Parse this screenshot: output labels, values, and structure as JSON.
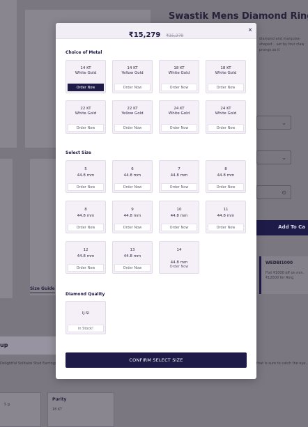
{
  "product": {
    "title": "Swastik Mens Diamond Ring",
    "description": "diamond and marquise-shaped... set by four claw prongs as it",
    "size_guide": "Size Guide",
    "add_to_cart": "Add To Ca",
    "offer": {
      "code": "WEDBI1000",
      "text": "Flat ₹1000 off on min. ₹12000 for Ring"
    }
  },
  "details": {
    "tab_label": "up",
    "paragraph_left": "Delightful Solitaire Stud Earrings... these earrings will stay in your...",
    "paragraph_right": "that is sure to catch the eye... your everyday look, the",
    "specs": [
      {
        "key": "",
        "value": "5 g"
      },
      {
        "key": "Purity",
        "value": "18 KT"
      }
    ]
  },
  "modal": {
    "price": "₹15,279",
    "old_price": "₹15,279",
    "close": "×",
    "metal_title": "Choice of Metal",
    "metal_options": [
      {
        "kt": "14 KT",
        "color": "White Gold",
        "action": "Order Now",
        "selected": true
      },
      {
        "kt": "14 KT",
        "color": "Yellow Gold",
        "action": "Order Now"
      },
      {
        "kt": "18 KT",
        "color": "White Gold",
        "action": "Order Now"
      },
      {
        "kt": "18 KT",
        "color": "White Gold",
        "action": "Order Now"
      },
      {
        "kt": "22 KT",
        "color": "White Gold",
        "action": "Order Now"
      },
      {
        "kt": "22 KT",
        "color": "Yellow Gold",
        "action": "Order Now"
      },
      {
        "kt": "24 KT",
        "color": "White Gold",
        "action": "Order Now"
      },
      {
        "kt": "24 KT",
        "color": "White Gold",
        "action": "Order Now"
      }
    ],
    "size_title": "Select Size",
    "size_options": [
      {
        "size": "5",
        "mm": "44.8 mm",
        "action": "Order Now"
      },
      {
        "size": "6",
        "mm": "44.8 mm",
        "action": "Order Now"
      },
      {
        "size": "7",
        "mm": "44.8 mm",
        "action": "Order Now"
      },
      {
        "size": "8",
        "mm": "44.8 mm",
        "action": "Order Now"
      },
      {
        "size": "8",
        "mm": "44.8 mm",
        "action": "Order Now"
      },
      {
        "size": "9",
        "mm": "44.8 mm",
        "action": "Order Now"
      },
      {
        "size": "10",
        "mm": "44.8 mm",
        "action": "Order Now"
      },
      {
        "size": "11",
        "mm": "44.8 mm",
        "action": "Order Now"
      },
      {
        "size": "12",
        "mm": "44.8 mm",
        "action": "Order Now"
      },
      {
        "size": "13",
        "mm": "44.8 mm",
        "action": "Order Now"
      },
      {
        "size": "14",
        "mm": "44.8 mm",
        "action": "Order Now"
      }
    ],
    "quality_title": "Diamond Quality",
    "quality_options": [
      {
        "grade": "IJ-SI",
        "stock": "in Stock!"
      }
    ],
    "confirm": "CONFIRM SELECT SIZE"
  },
  "colors": {
    "primary": "#1e1b48",
    "tile": "#f5f0f8",
    "overlay": "#7b7781"
  }
}
